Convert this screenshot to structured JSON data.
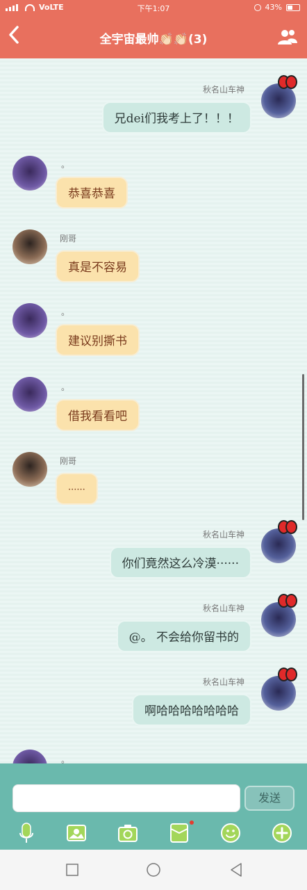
{
  "status": {
    "carrier": "VoLTE",
    "time": "下午1:07",
    "battery": "43%"
  },
  "header": {
    "title": "全宇宙最帅👏🏻👏🏻(3)"
  },
  "messages": [
    {
      "name": "秋名山车神",
      "text": "兄dei们我考上了！！！"
    },
    {
      "name": "。",
      "text": "恭喜恭喜"
    },
    {
      "name": "刚哥",
      "text": "真是不容易"
    },
    {
      "name": "。",
      "text": "建议别撕书"
    },
    {
      "name": "。",
      "text": "借我看看吧"
    },
    {
      "name": "刚哥",
      "text": "······"
    },
    {
      "name": "秋名山车神",
      "text": "你们竟然这么冷漠······"
    },
    {
      "name": "秋名山车神",
      "text": "@。 不会给你留书的"
    },
    {
      "name": "秋名山车神",
      "text": "啊哈哈哈哈哈哈哈"
    },
    {
      "name": "。",
      "text": ""
    }
  ],
  "input": {
    "placeholder": "",
    "send_label": "发送"
  },
  "colors": {
    "header": "#e8705e",
    "input_bar": "#6ab9ad",
    "bubble_left": "#fbe2ac",
    "bubble_right": "#cde9e2"
  },
  "icons": {
    "tools": [
      "microphone-icon",
      "image-icon",
      "camera-icon",
      "sticker-icon",
      "emoji-icon",
      "add-icon"
    ],
    "nav": [
      "recent-apps-icon",
      "home-icon",
      "back-icon"
    ]
  }
}
